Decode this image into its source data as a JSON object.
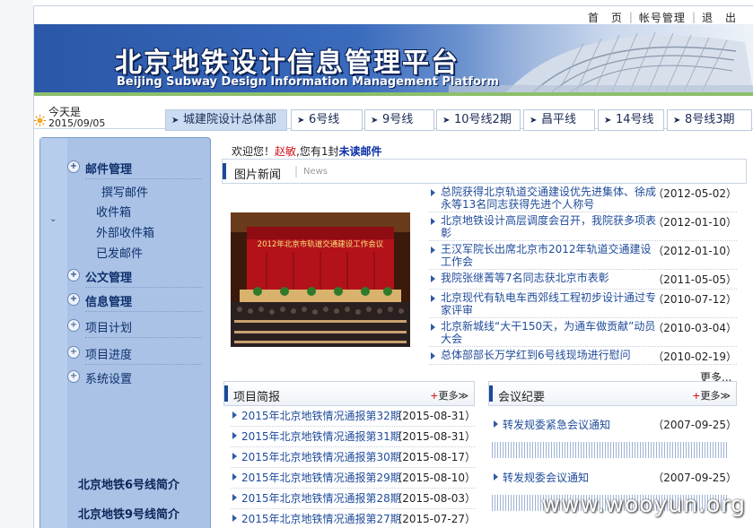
{
  "top_links": [
    "首　页",
    "帐号管理",
    "退　出"
  ],
  "banner": {
    "title": "北京地铁设计信息管理平台",
    "subtitle": "Beijing Subway Design Information Management Platform"
  },
  "today": {
    "label": "今天是",
    "date": "2015/09/05"
  },
  "nav_tabs": [
    "城建院设计总体部",
    "6号线",
    "9号线",
    "10号线2期",
    "昌平线",
    "14号线",
    "8号线3期"
  ],
  "sidebar": {
    "mail_header": "邮件管理",
    "mail_items": [
      "撰写邮件",
      "收件箱",
      "外部收件箱",
      "已发邮件"
    ],
    "doc_header": "公文管理",
    "info_header": "信息管理",
    "plan": "项目计划",
    "progress": "项目进度",
    "settings": "系统设置",
    "line6": "北京地铁6号线简介",
    "line9": "北京地铁9号线简介"
  },
  "welcome": {
    "prefix": "欢迎您！",
    "user": "赵敏",
    "middle": "您有",
    "count": "1",
    "unit": "封",
    "mail": "未读邮件"
  },
  "picnews": {
    "title": "图片新闻",
    "en": "News",
    "more": "更多..."
  },
  "photo_banner_text": "2012年北京市轨道交通建设工作会议",
  "news": [
    {
      "title": "总院获得北京轨道交通建设优先进集体、徐成永等13名同志获得先进个人称号",
      "date": "（2012-05-02）"
    },
    {
      "title": "北京地铁设计高层调度会召开，我院获多项表彰",
      "date": "（2012-01-10）"
    },
    {
      "title": "王汉军院长出席北京市2012年轨道交通建设工作会",
      "date": "（2012-01-10）"
    },
    {
      "title": "我院张继菁等7名同志获北京市表彰",
      "date": "（2011-05-05）"
    },
    {
      "title": "北京现代有轨电车西郊线工程初步设计通过专家评审",
      "date": "（2010-07-12）"
    },
    {
      "title": "北京新城线“大干150天，为通车做贡献”动员大会",
      "date": "（2010-03-04）"
    },
    {
      "title": "总体部部长万学红到6号线现场进行慰问",
      "date": "（2010-02-19）"
    }
  ],
  "project": {
    "title": "项目简报",
    "more_plus": "+",
    "more": "更多≫",
    "items": [
      {
        "title": "2015年北京地铁情况通报第32期",
        "date": "（2015-08-31）"
      },
      {
        "title": "2015年北京地铁情况通报第31期",
        "date": "（2015-08-31）"
      },
      {
        "title": "2015年北京地铁情况通报第30期",
        "date": "（2015-08-17）"
      },
      {
        "title": "2015年北京地铁情况通报第29期",
        "date": "（2015-08-10）"
      },
      {
        "title": "2015年北京地铁情况通报第28期",
        "date": "（2015-08-03）"
      },
      {
        "title": "2015年北京地铁情况通报第27期",
        "date": "（2015-07-27）"
      }
    ]
  },
  "meeting": {
    "title": "会议纪要",
    "more_plus": "+",
    "more": "更多≫",
    "items": [
      {
        "title": "转发规委紧急会议通知",
        "date": "（2007-09-25）"
      },
      {
        "title": "转发规委会议通知",
        "date": "（2007-09-25）"
      }
    ]
  },
  "watermark": "www.wooyun.org",
  "colors": {
    "banner_blue": "#2b57a8",
    "link_blue": "#1f4b9a",
    "sidebar_bg": "#a9c2e6",
    "user_red": "#d1121b"
  }
}
